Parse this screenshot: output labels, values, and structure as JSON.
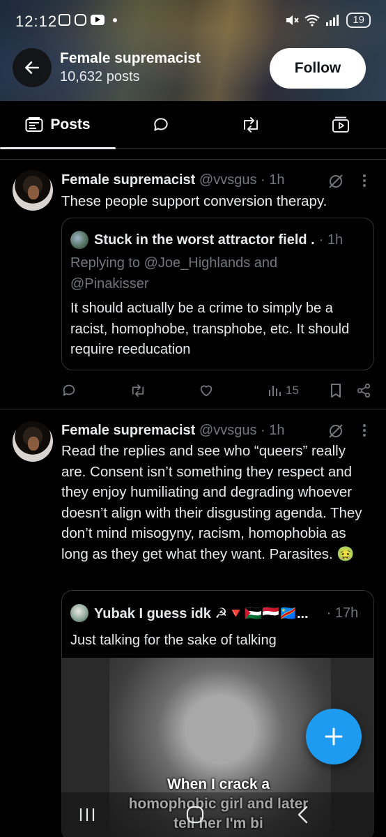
{
  "status_bar": {
    "time": "12:12",
    "battery": "19"
  },
  "profile": {
    "name": "Female supremacist",
    "posts_count": "10,632 posts",
    "follow_label": "Follow"
  },
  "tabs": [
    {
      "label": "Posts"
    }
  ],
  "posts": [
    {
      "author": "Female supremacist",
      "handle": "@vvsgus",
      "time": "· 1h",
      "text": "These people support conversion therapy.",
      "quote": {
        "author": "Stuck in the worst attractor field .",
        "time": "· 1h",
        "replying_line1": "Replying to @Joe_Highlands and",
        "replying_line2": "@Pinakisser",
        "text": "It should actually be a crime to simply be a racist, homophobe, transphobe, etc. It should require reeducation"
      },
      "views": "15"
    },
    {
      "author": "Female supremacist",
      "handle": "@vvsgus",
      "time": "· 1h",
      "text": "Read the replies and see who “queers” really are. Consent isn’t something they respect and they enjoy humiliating and degrading whoever doesn’t align with their disgusting agenda. They don’t mind misogyny, racism, homophobia as long as they get what they want. Parasites. 🤢",
      "quote": {
        "author": "Yubak I guess idk ☭🔻🇵🇸🇾🇪🇨🇩...",
        "time": "· 17h",
        "text": "Just talking for the sake of talking",
        "caption_line1": "When I crack a",
        "caption_line2": "homophobic girl and later",
        "caption_line3": "tell her I'm bi"
      }
    }
  ],
  "colors": {
    "accent": "#1d9bf0",
    "muted": "#71767b",
    "border": "#2f3336",
    "text": "#e7e9ea"
  }
}
